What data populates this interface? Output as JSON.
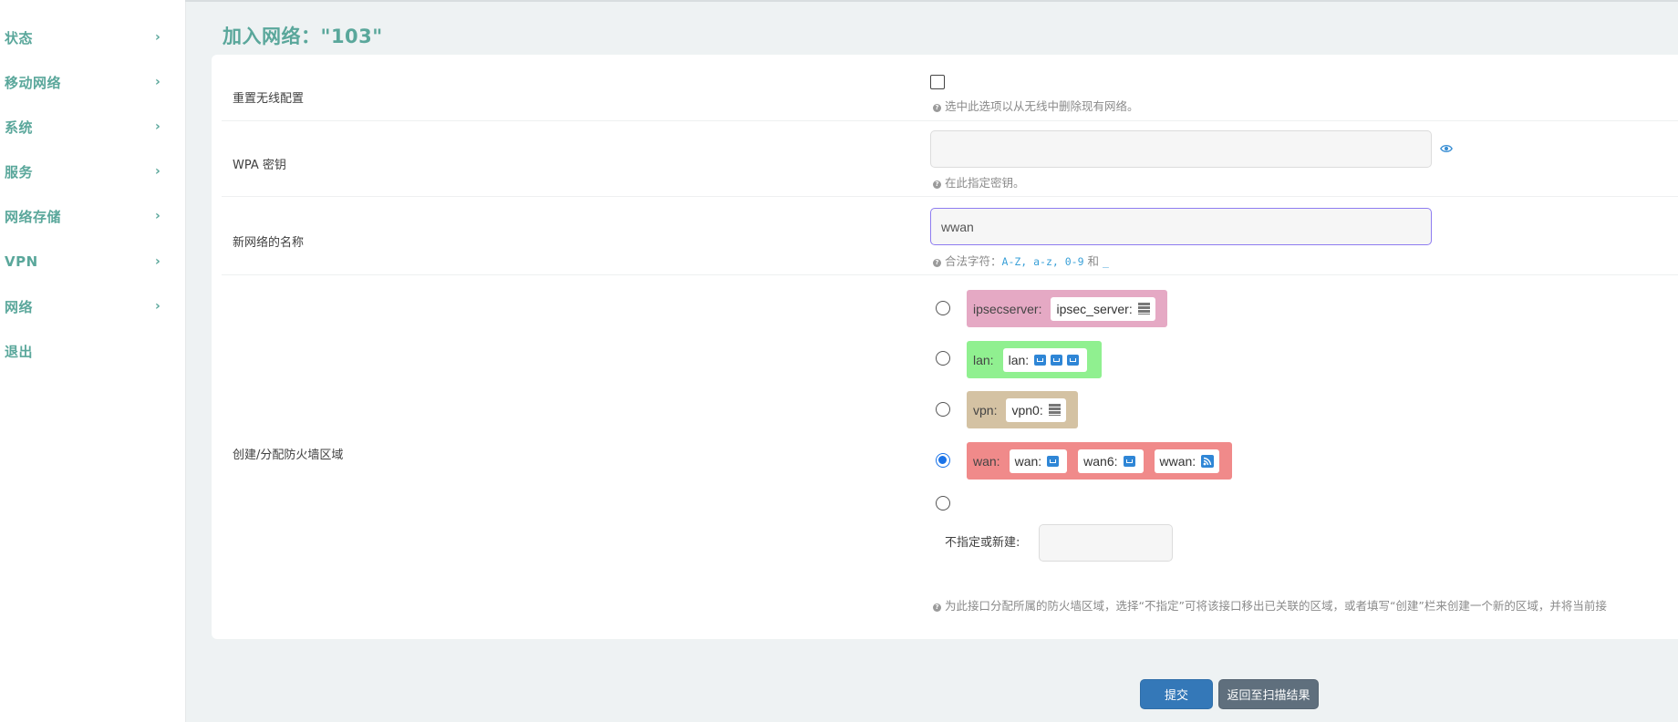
{
  "sidebar": {
    "items": [
      {
        "label": "状态"
      },
      {
        "label": "移动网络"
      },
      {
        "label": "系统"
      },
      {
        "label": "服务"
      },
      {
        "label": "网络存储"
      },
      {
        "label": "VPN"
      },
      {
        "label": "网络"
      },
      {
        "label": "退出"
      }
    ],
    "chevron": "›"
  },
  "page": {
    "title": "加入网络：\"103\""
  },
  "form": {
    "reset_wireless": {
      "label": "重置无线配置",
      "checked": false,
      "help": "选中此选项以从无线中删除现有网络。"
    },
    "wpa_key": {
      "label": "WPA 密钥",
      "value": "",
      "help": "在此指定密钥。"
    },
    "new_network_name": {
      "label": "新网络的名称",
      "value": "wwan",
      "help_prefix": "合法字符：",
      "help_chars": "A-Z, a-z, 0-9",
      "help_and": " 和 ",
      "help_underscore": "_"
    },
    "firewall_zone": {
      "label": "创建/分配防火墙区域",
      "zones": [
        {
          "name": "ipsecserver:",
          "color": "#e5a9c4",
          "selected": false,
          "interfaces": [
            {
              "label": "ipsec_server:",
              "icons": [
                "server-icon"
              ]
            }
          ]
        },
        {
          "name": "lan:",
          "color": "#90f090",
          "selected": false,
          "interfaces": [
            {
              "label": "lan:",
              "icons": [
                "ethernet-icon",
                "ethernet-icon",
                "ethernet-icon"
              ]
            }
          ]
        },
        {
          "name": "vpn:",
          "color": "#d4c2a3",
          "selected": false,
          "interfaces": [
            {
              "label": "vpn0:",
              "icons": [
                "server-icon"
              ]
            }
          ]
        },
        {
          "name": "wan:",
          "color": "#f08a8a",
          "selected": true,
          "interfaces": [
            {
              "label": "wan:",
              "icons": [
                "ethernet-icon"
              ]
            },
            {
              "label": "wan6:",
              "icons": [
                "ethernet-icon"
              ]
            },
            {
              "label": "wwan:",
              "icons": [
                "wifi-icon"
              ]
            }
          ]
        }
      ],
      "none_or_create_label": "不指定或新建:",
      "create_value": "",
      "help": "为此接口分配所属的防火墙区域，选择“不指定”可将该接口移出已关联的区域，或者填写“创建”栏来创建一个新的区域，并将当前接"
    }
  },
  "buttons": {
    "submit": "提交",
    "back": "返回至扫描结果"
  }
}
